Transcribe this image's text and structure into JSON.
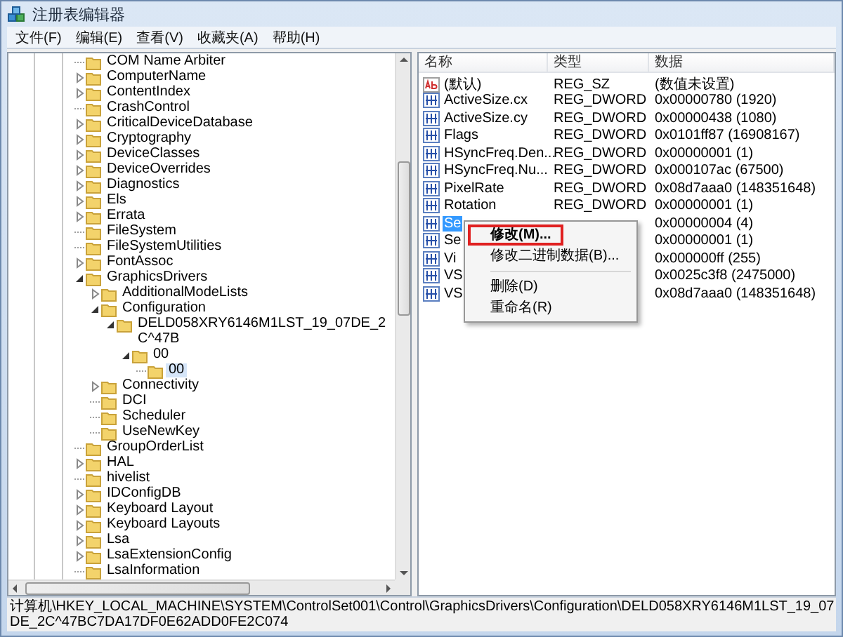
{
  "window": {
    "title": "注册表编辑器"
  },
  "menu_bar": [
    "文件(F)",
    "编辑(E)",
    "查看(V)",
    "收藏夹(A)",
    "帮助(H)"
  ],
  "tree": [
    {
      "label": "COM Name Arbiter",
      "selected": false
    },
    {
      "label": "ComputerName",
      "expanded": false,
      "selected": false
    },
    {
      "label": "ContentIndex",
      "expanded": false,
      "selected": false
    },
    {
      "label": "CrashControl",
      "selected": false
    },
    {
      "label": "CriticalDeviceDatabase",
      "expanded": false,
      "selected": false
    },
    {
      "label": "Cryptography",
      "expanded": false,
      "selected": false
    },
    {
      "label": "DeviceClasses",
      "expanded": false,
      "selected": false
    },
    {
      "label": "DeviceOverrides",
      "expanded": false,
      "selected": false
    },
    {
      "label": "Diagnostics",
      "expanded": false,
      "selected": false
    },
    {
      "label": "Els",
      "expanded": false,
      "selected": false
    },
    {
      "label": "Errata",
      "expanded": false,
      "selected": false
    },
    {
      "label": "FileSystem",
      "selected": false
    },
    {
      "label": "FileSystemUtilities",
      "selected": false
    },
    {
      "label": "FontAssoc",
      "expanded": false,
      "selected": false
    },
    {
      "label": "GraphicsDrivers",
      "expanded": true,
      "selected": false,
      "children": [
        {
          "label": "AdditionalModeLists",
          "expanded": false,
          "selected": false
        },
        {
          "label": "Configuration",
          "expanded": true,
          "selected": false,
          "children": [
            {
              "label": "DELD058XRY6146M1LST_19_07DE_2C^47B",
              "expanded": true,
              "selected": false,
              "children": [
                {
                  "label": "00",
                  "expanded": true,
                  "selected": false,
                  "children": [
                    {
                      "label": "00",
                      "selected": true
                    }
                  ]
                }
              ]
            }
          ]
        },
        {
          "label": "Connectivity",
          "expanded": false,
          "selected": false
        },
        {
          "label": "DCI",
          "selected": false
        },
        {
          "label": "Scheduler",
          "selected": false
        },
        {
          "label": "UseNewKey",
          "selected": false
        }
      ]
    },
    {
      "label": "GroupOrderList",
      "selected": false
    },
    {
      "label": "HAL",
      "expanded": false,
      "selected": false
    },
    {
      "label": "hivelist",
      "selected": false
    },
    {
      "label": "IDConfigDB",
      "expanded": false,
      "selected": false
    },
    {
      "label": "Keyboard Layout",
      "expanded": false,
      "selected": false
    },
    {
      "label": "Keyboard Layouts",
      "expanded": false,
      "selected": false
    },
    {
      "label": "Lsa",
      "expanded": false,
      "selected": false
    },
    {
      "label": "LsaExtensionConfig",
      "expanded": false,
      "selected": false
    },
    {
      "label": "LsaInformation",
      "selected": false
    }
  ],
  "values": {
    "columns": [
      "名称",
      "类型",
      "数据"
    ],
    "rows": [
      {
        "kind": "sz",
        "name": "(默认)",
        "type": "REG_SZ",
        "data": "(数值未设置)",
        "selected": false
      },
      {
        "kind": "dword",
        "name": "ActiveSize.cx",
        "type": "REG_DWORD",
        "data": "0x00000780 (1920)",
        "selected": false
      },
      {
        "kind": "dword",
        "name": "ActiveSize.cy",
        "type": "REG_DWORD",
        "data": "0x00000438 (1080)",
        "selected": false
      },
      {
        "kind": "dword",
        "name": "Flags",
        "type": "REG_DWORD",
        "data": "0x0101ff87 (16908167)",
        "selected": false
      },
      {
        "kind": "dword",
        "name": "HSyncFreq.Den...",
        "type": "REG_DWORD",
        "data": "0x00000001 (1)",
        "selected": false
      },
      {
        "kind": "dword",
        "name": "HSyncFreq.Nu...",
        "type": "REG_DWORD",
        "data": "0x000107ac (67500)",
        "selected": false
      },
      {
        "kind": "dword",
        "name": "PixelRate",
        "type": "REG_DWORD",
        "data": "0x08d7aaa0 (148351648)",
        "selected": false
      },
      {
        "kind": "dword",
        "name": "Rotation",
        "type": "REG_DWORD",
        "data": "0x00000001 (1)",
        "selected": false
      },
      {
        "kind": "dword",
        "name": "Se",
        "data": "0x00000004 (4)",
        "selected": true
      },
      {
        "kind": "dword",
        "name": "Se",
        "data": "0x00000001 (1)",
        "selected": false
      },
      {
        "kind": "dword",
        "name": "Vi",
        "data": "0x000000ff (255)",
        "selected": false
      },
      {
        "kind": "dword",
        "name": "VS",
        "data": "0x0025c3f8 (2475000)",
        "selected": false
      },
      {
        "kind": "dword",
        "name": "VS",
        "data": "0x08d7aaa0 (148351648)",
        "selected": false
      }
    ]
  },
  "context_menu": {
    "items": [
      {
        "kind": "item",
        "label": "修改(M)...",
        "default": true,
        "annotated": true
      },
      {
        "kind": "item",
        "label": "修改二进制数据(B)...",
        "default": false,
        "annotated": false
      },
      {
        "kind": "separator"
      },
      {
        "kind": "item",
        "label": "删除(D)",
        "default": false,
        "annotated": false
      },
      {
        "kind": "item",
        "label": "重命名(R)",
        "default": false,
        "annotated": false
      }
    ]
  },
  "status_bar": "计算机\\HKEY_LOCAL_MACHINE\\SYSTEM\\ControlSet001\\Control\\GraphicsDrivers\\Configuration\\DELD058XRY6146M1LST_19_07DE_2C^47BC7DA17DF0E62ADD0FE2C074"
}
